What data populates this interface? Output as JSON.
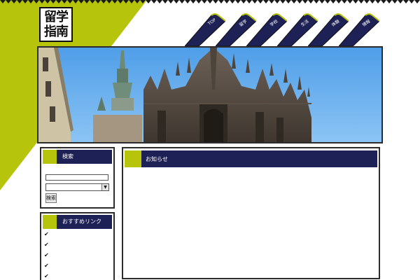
{
  "logo": {
    "line1": "留学",
    "line2": "指南"
  },
  "nav": {
    "tabs": [
      {
        "label": "TOP"
      },
      {
        "label": "留学"
      },
      {
        "label": "学校"
      },
      {
        "label": "生活"
      },
      {
        "label": "体験"
      },
      {
        "label": "情報"
      }
    ]
  },
  "hero": {
    "icon": "cathedral-photo"
  },
  "search_panel": {
    "title": "検索",
    "input_value": "",
    "select_value": "",
    "button_label": "検索"
  },
  "links_panel": {
    "title": "おすすめリンク",
    "items": [
      {
        "icon": "check-icon",
        "label": ""
      },
      {
        "icon": "check-icon",
        "label": ""
      },
      {
        "icon": "check-icon",
        "label": ""
      },
      {
        "icon": "check-icon",
        "label": ""
      },
      {
        "icon": "check-icon",
        "label": ""
      }
    ]
  },
  "main_panel": {
    "title": "お知らせ"
  },
  "colors": {
    "navy": "#1e2156",
    "olive": "#b6c40c",
    "border": "#2c2c2c",
    "sky": "#6aaff0"
  }
}
